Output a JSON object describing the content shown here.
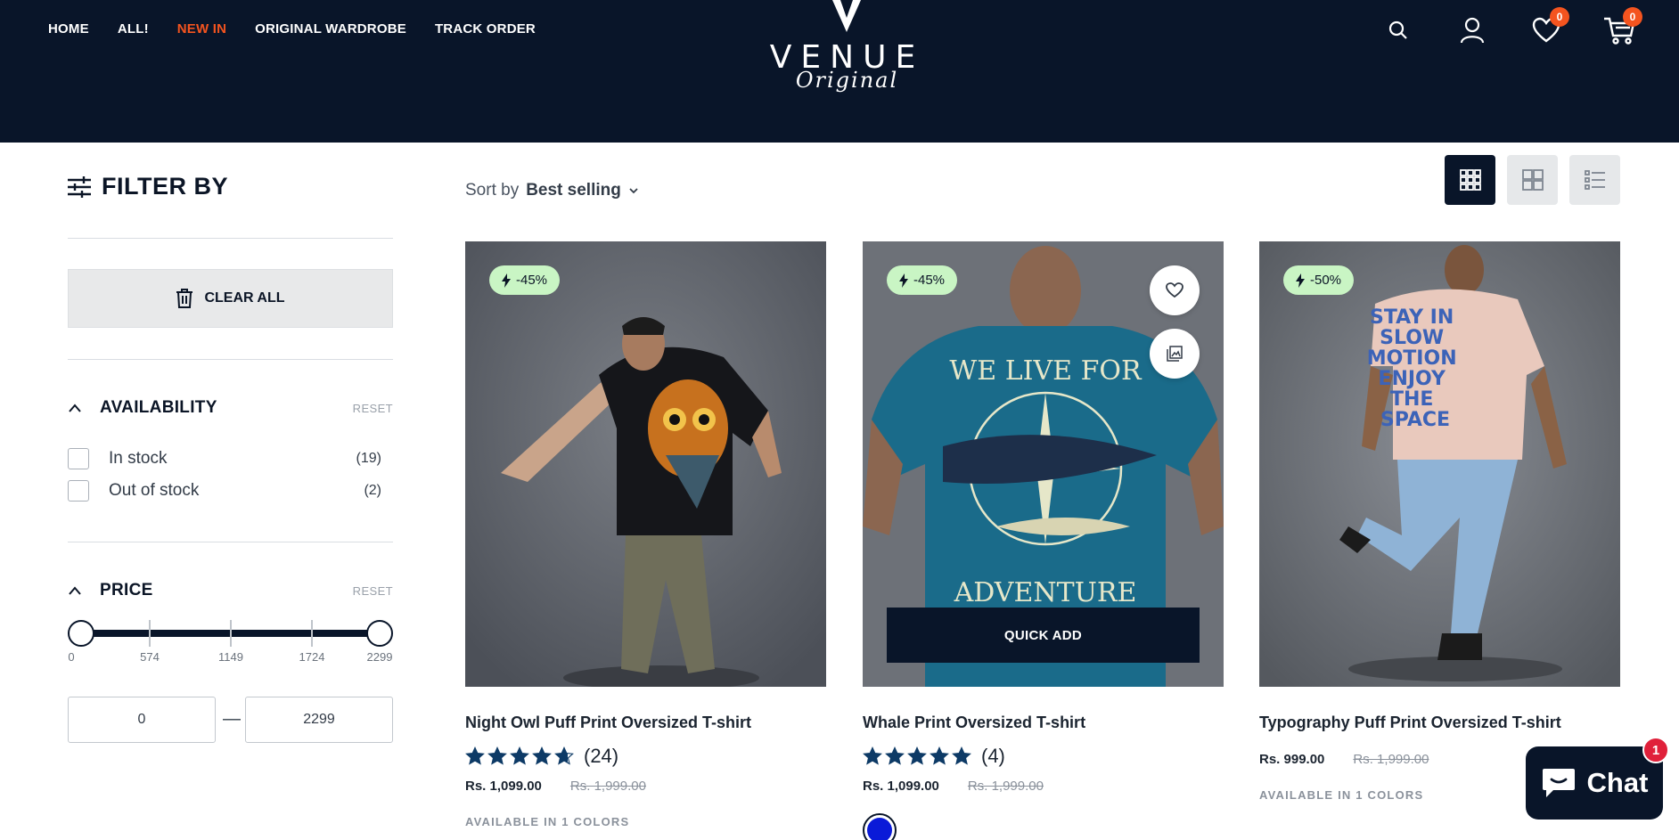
{
  "header": {
    "nav": [
      "HOME",
      "ALL!",
      "NEW IN",
      "ORIGINAL WARDROBE",
      "TRACK ORDER"
    ],
    "logo_word": "VENUE",
    "logo_script": "Original",
    "wishlist_count": "0",
    "cart_count": "0",
    "colors": {
      "background": "#091529",
      "accent": "#f4541f"
    }
  },
  "sidebar": {
    "title": "FILTER BY",
    "clear_all": "CLEAR ALL",
    "availability": {
      "label": "AVAILABILITY",
      "reset": "RESET",
      "options": [
        {
          "label": "In stock",
          "count": "(19)"
        },
        {
          "label": "Out of stock",
          "count": "(2)"
        }
      ]
    },
    "price": {
      "label": "PRICE",
      "reset": "RESET",
      "scale": [
        "0",
        "574",
        "1149",
        "1724",
        "2299"
      ],
      "min": "0",
      "max": "2299",
      "separator": "—"
    }
  },
  "toolbar": {
    "sort_label": "Sort by",
    "sort_value": "Best selling",
    "view_modes": [
      "grid-3",
      "grid-2",
      "list"
    ],
    "active_view": "grid-3"
  },
  "products": [
    {
      "name": "Night Owl Puff Print Oversized T-shirt",
      "discount": "-45%",
      "rating": 4.7,
      "reviews": "(24)",
      "price": "Rs. 1,099.00",
      "compare_price": "Rs. 1,999.00",
      "colors_text": "AVAILABLE IN 1 COLORS"
    },
    {
      "name": "Whale Print Oversized T-shirt",
      "discount": "-45%",
      "rating": 5,
      "reviews": "(4)",
      "price": "Rs. 1,099.00",
      "compare_price": "Rs. 1,999.00",
      "quick_add": "QUICK ADD",
      "swatch_color": "#0a1ad8",
      "print_top": "WE LIVE FOR",
      "print_bottom": "ADVENTURE"
    },
    {
      "name": "Typography Puff Print Oversized T-shirt",
      "discount": "-50%",
      "price": "Rs. 999.00",
      "compare_price": "Rs. 1,999.00",
      "colors_text": "AVAILABLE IN 1 COLORS",
      "print_text": [
        "STAY IN",
        "SLOW",
        "MOTION",
        "ENJOY",
        "THE",
        "SPACE"
      ]
    }
  ],
  "chat": {
    "label": "Chat",
    "badge": "1"
  }
}
